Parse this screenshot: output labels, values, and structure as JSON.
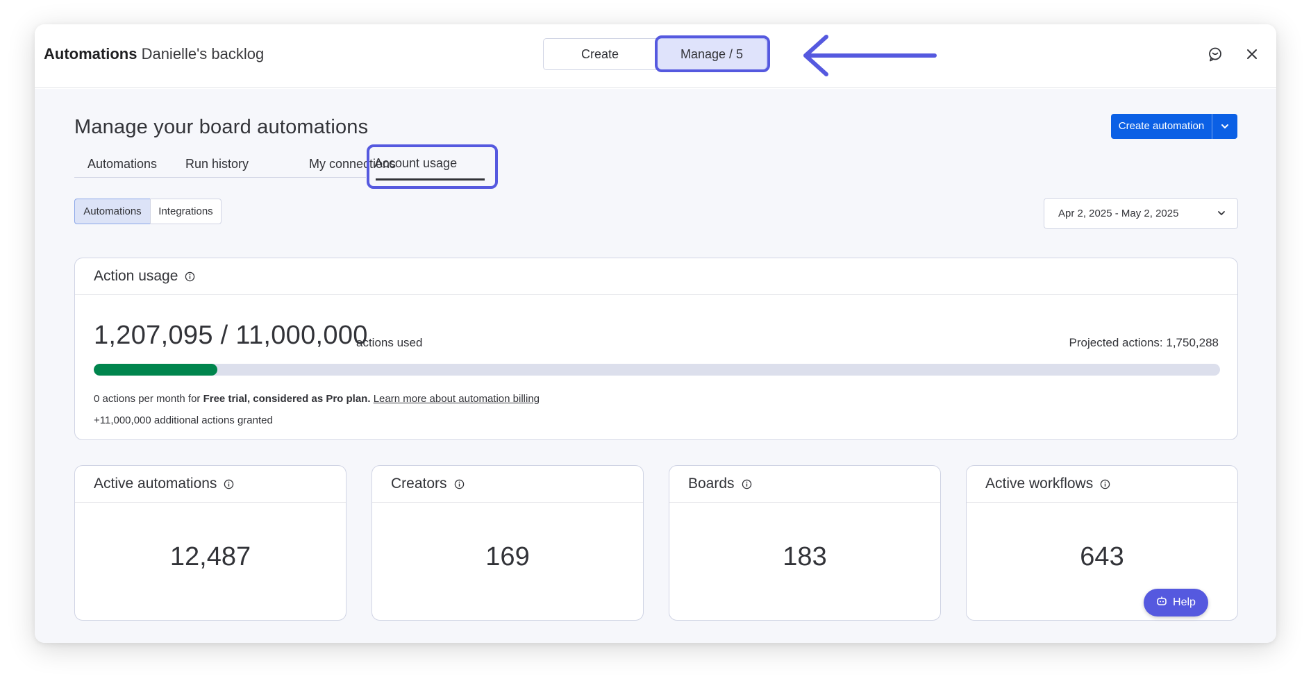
{
  "header": {
    "app_title": "Automations",
    "board_name": "Danielle's backlog",
    "create_label": "Create",
    "manage_label": "Manage / 5",
    "feedback_icon": "feedback-icon",
    "close_icon": "close-icon"
  },
  "main": {
    "page_title": "Manage your board automations",
    "create_button_label": "Create automation",
    "tabs": [
      {
        "label": "Automations"
      },
      {
        "label": "Run history"
      },
      {
        "label": "My connections"
      },
      {
        "label": "Account usage",
        "active": true
      }
    ],
    "toggle": {
      "automations": "Automations",
      "integrations": "Integrations",
      "selected": "Automations"
    },
    "date_range": "Apr 2, 2025 - May 2, 2025"
  },
  "action_usage": {
    "title": "Action usage",
    "used_text": "1,207,095 / 11,000,000",
    "used_suffix": "actions used",
    "projected_text": "Projected actions: 1,750,288",
    "progress_fraction": 0.1097,
    "note_prefix": "0 actions per month for ",
    "note_plan": "Free trial, considered as Pro plan.",
    "note_link": "Learn more about automation billing",
    "additional": "+11,000,000 additional actions granted"
  },
  "stats": [
    {
      "title": "Active automations",
      "value": "12,487"
    },
    {
      "title": "Creators",
      "value": "169"
    },
    {
      "title": "Boards",
      "value": "183"
    },
    {
      "title": "Active workflows",
      "value": "643"
    }
  ],
  "help_label": "Help",
  "colors": {
    "accent": "#5559df",
    "primary_button": "#0b60e5",
    "progress_fill": "#00854d",
    "progress_track": "#dcdfec"
  }
}
